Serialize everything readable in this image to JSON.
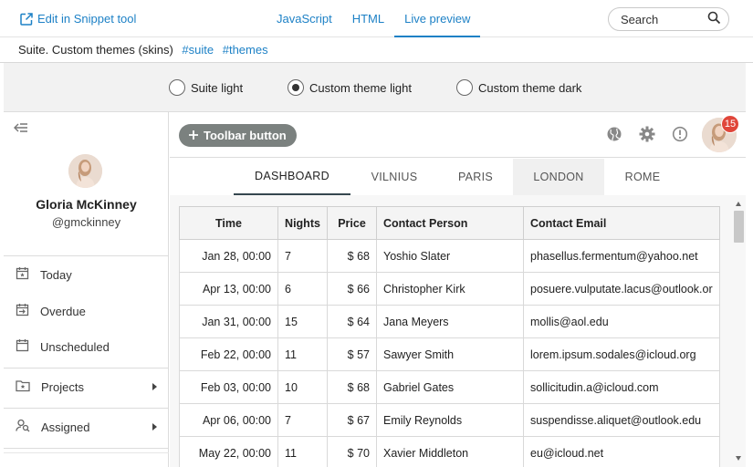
{
  "snippet": {
    "edit_link": "Edit in Snippet tool",
    "tabs": [
      {
        "label": "JavaScript"
      },
      {
        "label": "HTML"
      },
      {
        "label": "Live preview",
        "active": true
      }
    ],
    "search_label": "Search"
  },
  "description": {
    "title": "Suite. Custom themes (skins)",
    "tags": [
      "#suite",
      "#themes"
    ]
  },
  "themes": {
    "options": [
      {
        "label": "Suite light",
        "selected": false
      },
      {
        "label": "Custom theme light",
        "selected": true
      },
      {
        "label": "Custom theme dark",
        "selected": false
      }
    ]
  },
  "sidebar": {
    "user_name": "Gloria McKinney",
    "user_login": "@gmckinney",
    "items": [
      {
        "label": "Today",
        "icon": "calendar-today-icon"
      },
      {
        "label": "Overdue",
        "icon": "calendar-overdue-icon"
      },
      {
        "label": "Unscheduled",
        "icon": "calendar-blank-icon"
      },
      {
        "label": "Projects",
        "icon": "folder-star-icon",
        "has_submenu": true
      },
      {
        "label": "Assigned",
        "icon": "account-search-icon",
        "has_submenu": true
      }
    ]
  },
  "toolbar": {
    "button_label": "Toolbar button",
    "notification_count": "15",
    "icons": [
      "globe-icon",
      "gear-icon",
      "alert-circle-icon"
    ]
  },
  "tabs": [
    {
      "label": "DASHBOARD",
      "active": true
    },
    {
      "label": "VILNIUS"
    },
    {
      "label": "PARIS"
    },
    {
      "label": "LONDON",
      "highlighted": true
    },
    {
      "label": "ROME"
    }
  ],
  "grid": {
    "columns": [
      "Time",
      "Nights",
      "Price",
      "Contact Person",
      "Contact Email"
    ],
    "rows": [
      [
        "Jan 28, 00:00",
        "7",
        "$ 68",
        "Yoshio Slater",
        "phasellus.fermentum@yahoo.net"
      ],
      [
        "Apr 13, 00:00",
        "6",
        "$ 66",
        "Christopher Kirk",
        "posuere.vulputate.lacus@outlook.or"
      ],
      [
        "Jan 31, 00:00",
        "15",
        "$ 64",
        "Jana Meyers",
        "mollis@aol.edu"
      ],
      [
        "Feb 22, 00:00",
        "11",
        "$ 57",
        "Sawyer Smith",
        "lorem.ipsum.sodales@icloud.org"
      ],
      [
        "Feb 03, 00:00",
        "10",
        "$ 68",
        "Gabriel Gates",
        "sollicitudin.a@icloud.com"
      ],
      [
        "Apr 06, 00:00",
        "7",
        "$ 67",
        "Emily Reynolds",
        "suspendisse.aliquet@outlook.edu"
      ],
      [
        "May 22, 00:00",
        "11",
        "$ 70",
        "Xavier Middleton",
        "eu@icloud.net"
      ]
    ]
  },
  "colors": {
    "link": "#1d81c6",
    "toolbar_button": "#7b817f",
    "badge": "#e0463a",
    "tab_underline": "#36474f"
  }
}
